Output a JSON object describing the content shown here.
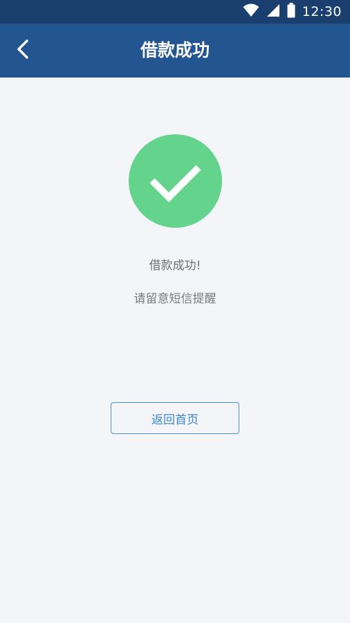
{
  "status_bar": {
    "time": "12:30",
    "icons": [
      "wifi-icon",
      "signal-icon",
      "battery-icon"
    ]
  },
  "app_bar": {
    "title": "借款成功",
    "back_icon": "chevron-left-icon"
  },
  "result": {
    "icon": "checkmark-icon",
    "primary_message": "借款成功!",
    "secondary_message": "请留意短信提醒"
  },
  "actions": {
    "home_button_label": "返回首页"
  },
  "colors": {
    "status_bar_bg": "#1a3f6e",
    "app_bar_bg": "#235591",
    "page_bg": "#f3f5f9",
    "success_green": "#64d38b",
    "button_blue": "#3d86cf"
  }
}
